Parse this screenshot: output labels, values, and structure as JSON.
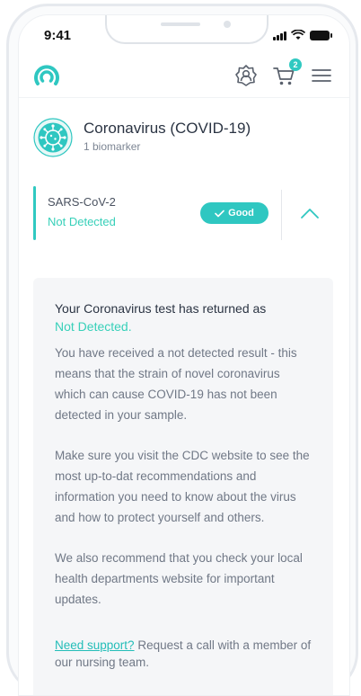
{
  "status_bar": {
    "time": "9:41"
  },
  "header": {
    "logo_icon": "app-logo-icon",
    "cart_count": "2",
    "icons": [
      "person-badge-icon",
      "cart-icon",
      "menu-icon"
    ]
  },
  "test": {
    "title": "Coronavirus (COVID-19)",
    "subtitle": "1 biomarker",
    "icon": "virus-icon"
  },
  "result": {
    "marker": "SARS-CoV-2",
    "status": "Not Detected",
    "badge_label": "Good",
    "accent_color": "#2fc7c1"
  },
  "details": {
    "heading": "Your Coronavirus test has returned as",
    "status": "Not Detected.",
    "paragraphs": [
      "You have received a not detected result - this means that the strain of novel coronavirus which can cause COVID-19 has not been detected in your sample.",
      "Make sure you visit the CDC website to see the most up-to-dat recommendations and information you need to know about the virus and how to protect yourself and others.",
      "We also recommend that you check your local health departments website for important updates."
    ],
    "support_link": "Need support?",
    "support_text": " Request a call with a member of our nursing team."
  }
}
